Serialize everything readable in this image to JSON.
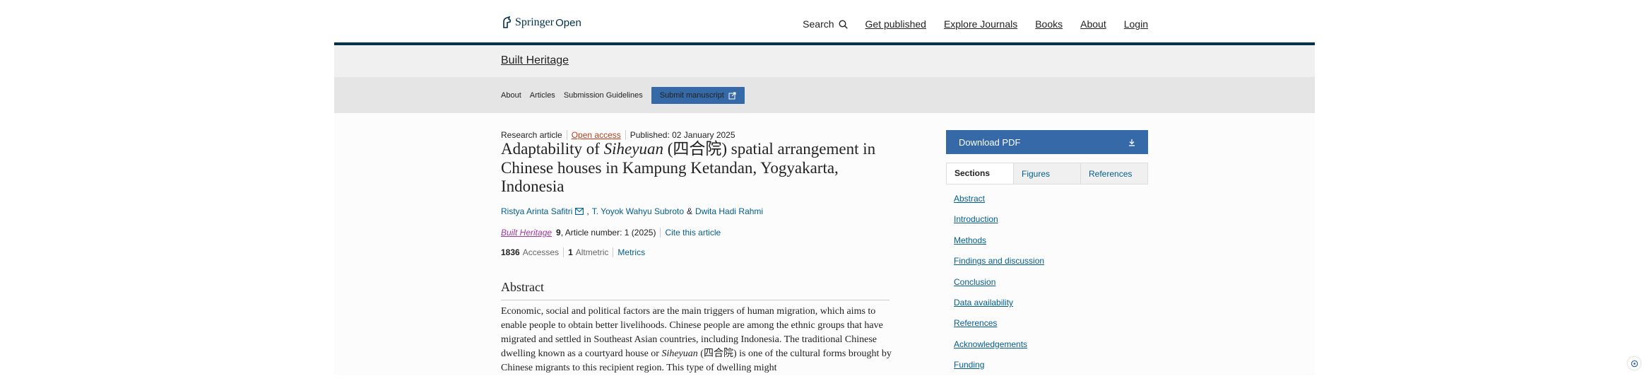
{
  "header": {
    "brand": "Springer",
    "brand_suffix": "Open",
    "search_label": "Search",
    "nav": [
      "Get published",
      "Explore Journals",
      "Books",
      "About",
      "Login"
    ]
  },
  "journal_bar": {
    "title": "Built Heritage"
  },
  "subnav": {
    "about": "About",
    "articles": "Articles",
    "guidelines": "Submission Guidelines",
    "submit": "Submit manuscript"
  },
  "article": {
    "type": "Research article",
    "open_access": "Open access",
    "published": "Published: 02 January 2025",
    "title_before": "Adaptability of ",
    "title_italic": "Siheyuan",
    "title_after": " (四合院) spatial arrangement in Chinese houses in Kampung Ketandan, Yogyakarta, Indonesia",
    "authors": [
      "Ristya Arinta Safitri",
      "T. Yoyok Wahyu Subroto",
      "Dwita Hadi Rahmi"
    ],
    "author_joiner": "&",
    "journal": "Built Heritage",
    "volume": "9",
    "article_number": ", Article number: 1 (2025)",
    "cite": "Cite this article",
    "accesses": "1836",
    "accesses_label": "Accesses",
    "altmetric": "1",
    "altmetric_label": "Altmetric",
    "metrics_link": "Metrics"
  },
  "abstract": {
    "heading": "Abstract",
    "text_before": "Economic, social and political factors are the main triggers of human migration, which aims to enable people to obtain better livelihoods. Chinese people are among the ethnic groups that have migrated and settled in Southeast Asian countries, including Indonesia. The traditional Chinese dwelling known as a courtyard house or ",
    "text_italic": "Siheyuan",
    "text_after": " (四合院) is one of the cultural forms brought by Chinese migrants to this recipient region. This type of dwelling might"
  },
  "sidebar": {
    "download": "Download PDF",
    "tabs": [
      "Sections",
      "Figures",
      "References"
    ],
    "sections": [
      "Abstract",
      "Introduction",
      "Methods",
      "Findings and discussion",
      "Conclusion",
      "Data availability",
      "References",
      "Acknowledgements",
      "Funding"
    ]
  },
  "colors": {
    "navy": "#01324b",
    "button": "#3569a7",
    "link": "#025e8d",
    "open_access": "#b7401b",
    "journal_link": "#a336a1"
  }
}
